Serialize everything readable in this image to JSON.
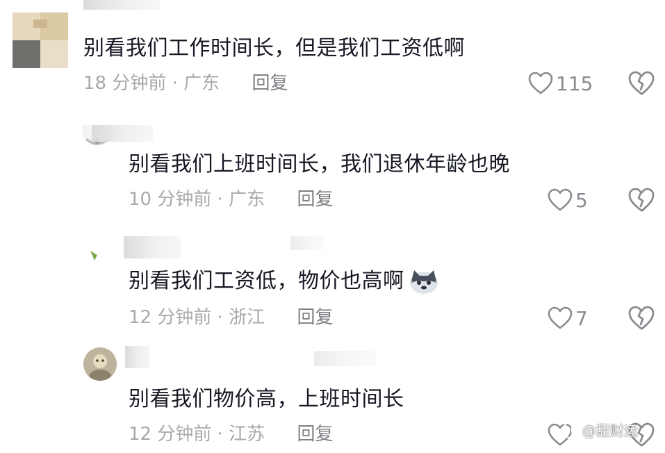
{
  "comments": [
    {
      "text": "别看我们工作时间长，但是我们工资低啊",
      "time": "18 分钟前",
      "location": "广东",
      "reply_label": "回复",
      "likes": "115"
    },
    {
      "text": "别看我们上班时间长，我们退休年龄也晚",
      "time": "10 分钟前",
      "location": "广东",
      "reply_label": "回复",
      "likes": "5"
    },
    {
      "text": "别看我们工资低，物价也高啊",
      "time": "12 分钟前",
      "location": "浙江",
      "reply_label": "回复",
      "likes": "7"
    },
    {
      "text": "别看我们物价高，上班时间长",
      "time": "12 分钟前",
      "location": "江苏",
      "reply_label": "回复",
      "likes": ""
    }
  ],
  "watermark": {
    "text": "@甜财运"
  },
  "colors": {
    "text": "#161823",
    "meta": "#a8a8ad",
    "icon": "#8a8a90"
  },
  "icons": {
    "like": "heart-outline-icon",
    "dislike": "broken-heart-icon"
  }
}
